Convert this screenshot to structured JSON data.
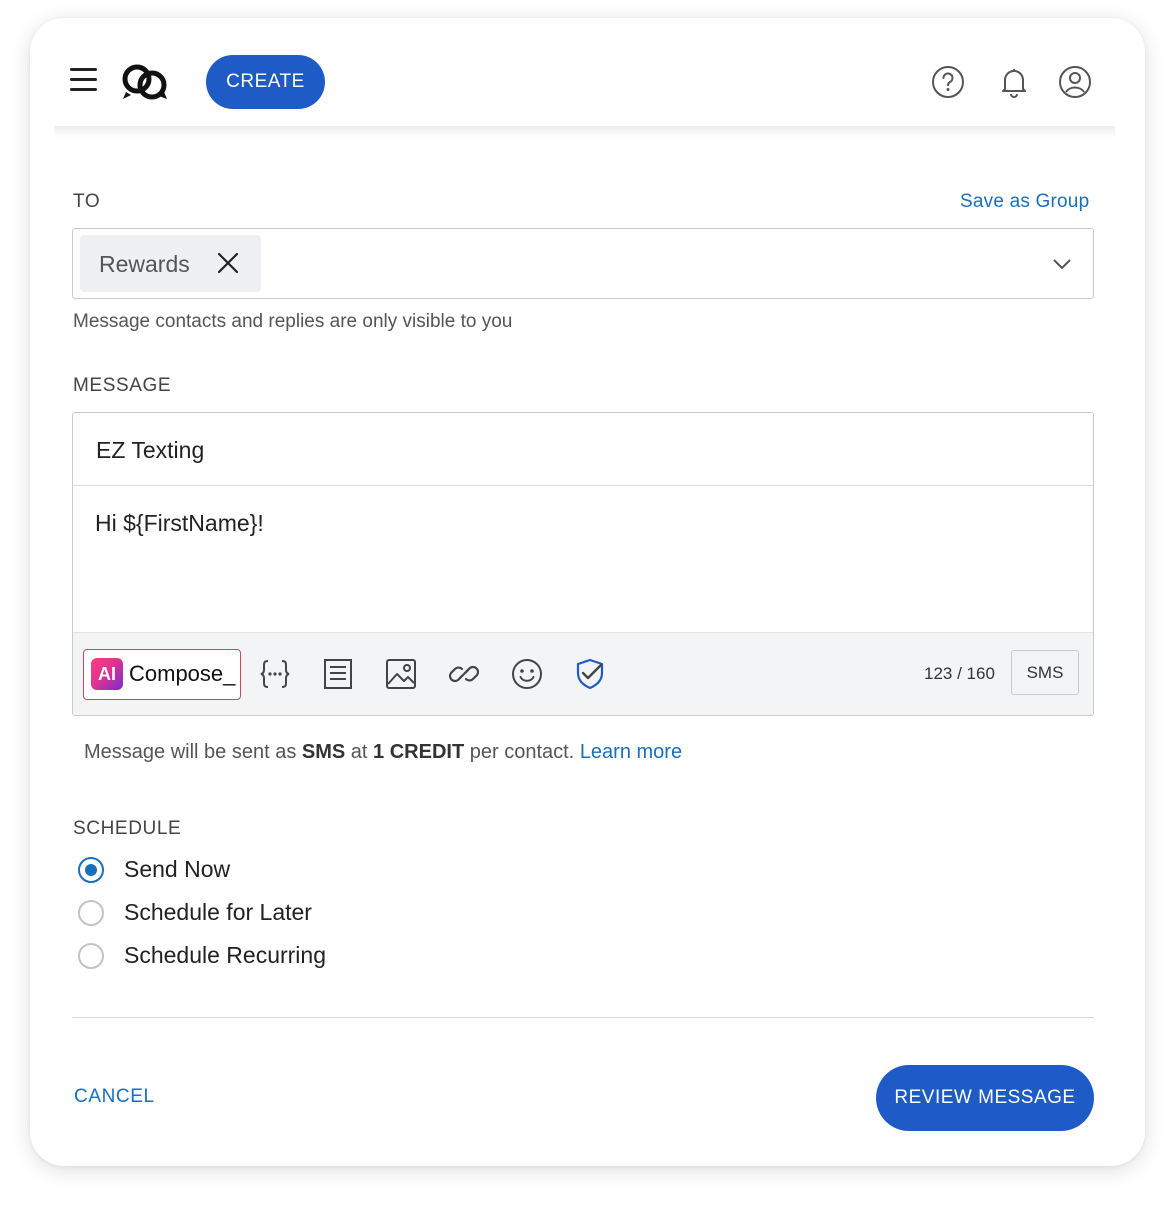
{
  "header": {
    "create_label": "CREATE",
    "icons": [
      "menu-icon",
      "logo-icon",
      "help-icon",
      "bell-icon",
      "account-icon"
    ]
  },
  "to": {
    "label": "TO",
    "save_group_label": "Save as Group",
    "chips": [
      {
        "label": "Rewards"
      }
    ],
    "hint": "Message contacts and replies are only visible to you"
  },
  "message": {
    "label": "MESSAGE",
    "sender_name": "EZ Texting",
    "body": "Hi ${FirstName}!",
    "ai_badge": "AI",
    "ai_compose_label": "Compose_",
    "toolbar_icons": [
      "variables-icon",
      "template-icon",
      "image-icon",
      "link-icon",
      "emoji-icon",
      "shield-check-icon"
    ],
    "counter": "123 / 160",
    "type_label": "SMS",
    "info": {
      "prefix": "Message will be sent as",
      "type": "SMS",
      "middle": "at",
      "credits": "1 CREDIT",
      "suffix": "per contact.",
      "learn_more": "Learn more"
    }
  },
  "schedule": {
    "label": "SCHEDULE",
    "options": [
      {
        "label": "Send Now",
        "selected": true
      },
      {
        "label": "Schedule for Later",
        "selected": false
      },
      {
        "label": "Schedule Recurring",
        "selected": false
      }
    ]
  },
  "footer": {
    "cancel_label": "CANCEL",
    "review_label": "REVIEW MESSAGE"
  },
  "colors": {
    "primary": "#1e5bc6",
    "link": "#1a6fbd",
    "ai_border": "#d1455f"
  }
}
